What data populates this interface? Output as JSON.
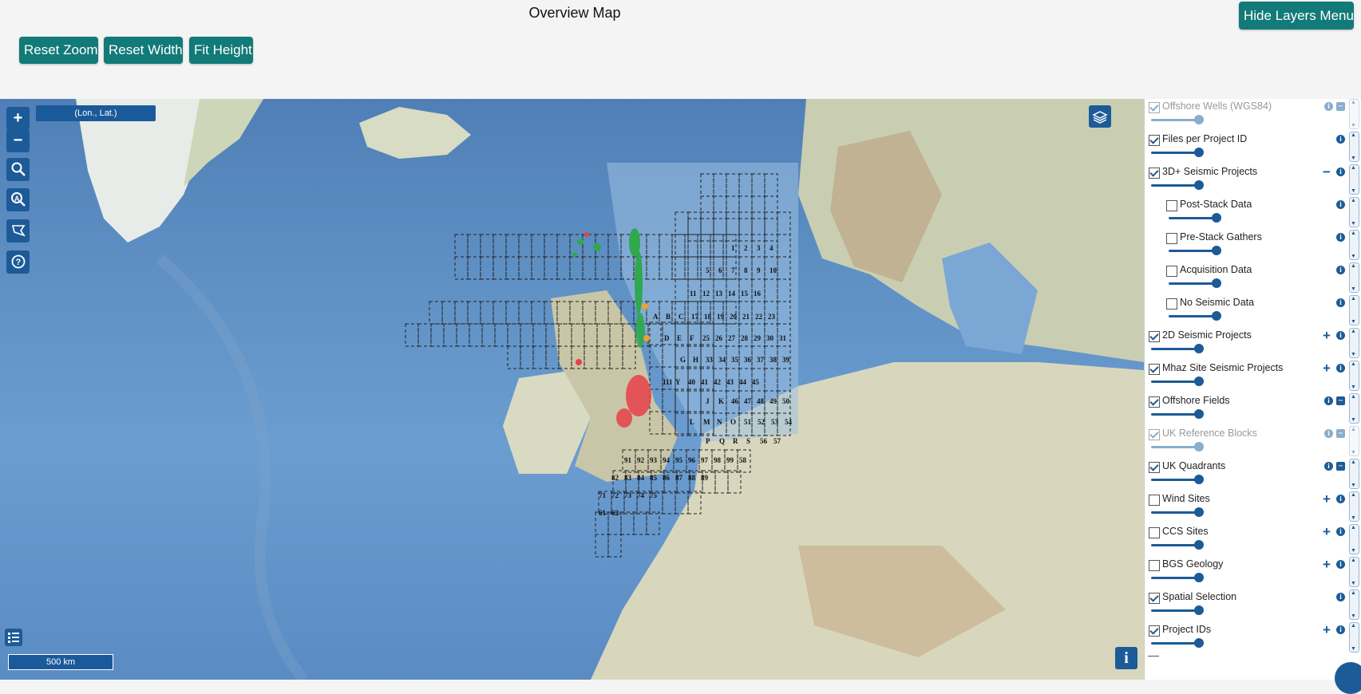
{
  "header": {
    "title": "Overview Map",
    "buttons": {
      "reset_zoom": "Reset Zoom",
      "reset_width": "Reset Width",
      "fit_height": "Fit Height",
      "hide_layers": "Hide Layers Menu"
    }
  },
  "map": {
    "coord_readout": "(Lon., Lat.)",
    "scale_label": "500 km",
    "controls": [
      "zoom-in-icon",
      "zoom-out-icon",
      "search-icon",
      "search-area-icon",
      "map-select-icon",
      "help-icon"
    ],
    "info_label": "i",
    "block_labels": {
      "row1": [
        "1",
        "2",
        "3",
        "4"
      ],
      "row2": [
        "5",
        "6",
        "7",
        "8",
        "9",
        "10"
      ],
      "row3": [
        "11",
        "12",
        "13",
        "14",
        "15",
        "16"
      ],
      "row4": [
        "A",
        "B",
        "C",
        "17",
        "18",
        "19",
        "20",
        "21",
        "22",
        "23"
      ],
      "row5": [
        "D",
        "E",
        "F",
        "25",
        "26",
        "27",
        "28",
        "29",
        "30",
        "31"
      ],
      "row6": [
        "G",
        "H",
        "33",
        "34",
        "35",
        "36",
        "37",
        "38",
        "39"
      ],
      "row7": [
        "111",
        "Y",
        "40",
        "41",
        "42",
        "43",
        "44",
        "45"
      ],
      "row8": [
        "J",
        "K",
        "46",
        "47",
        "48",
        "49",
        "50"
      ],
      "row9": [
        "L",
        "M",
        "N",
        "O",
        "51",
        "52",
        "53",
        "54"
      ],
      "row10": [
        "P",
        "Q",
        "R",
        "S",
        "56",
        "57"
      ],
      "row11": [
        "91",
        "92",
        "93",
        "94",
        "95",
        "96",
        "97",
        "98",
        "99",
        "58"
      ],
      "row12": [
        "82",
        "83",
        "84",
        "85",
        "86",
        "87",
        "88",
        "89"
      ],
      "row13": [
        "71",
        "72",
        "73",
        "74",
        "75"
      ],
      "row14": [
        "61",
        "62"
      ]
    }
  },
  "layers": [
    {
      "label": "Offshore Wells (WGS84)",
      "checked": true,
      "dim": true,
      "indent": 0,
      "icons": [
        "info-icon",
        "legend-icon"
      ]
    },
    {
      "label": "Files per Project ID",
      "checked": true,
      "dim": false,
      "indent": 0,
      "icons": [
        "info-icon"
      ]
    },
    {
      "label": "3D+ Seismic Projects",
      "checked": true,
      "dim": false,
      "indent": 0,
      "icons": [
        "collapse-icon",
        "info-icon"
      ]
    },
    {
      "label": "Post-Stack Data",
      "checked": false,
      "dim": false,
      "indent": 1,
      "icons": [
        "info-icon"
      ]
    },
    {
      "label": "Pre-Stack Gathers",
      "checked": false,
      "dim": false,
      "indent": 1,
      "icons": [
        "info-icon"
      ]
    },
    {
      "label": "Acquisition Data",
      "checked": false,
      "dim": false,
      "indent": 1,
      "icons": [
        "info-icon"
      ]
    },
    {
      "label": "No Seismic Data",
      "checked": false,
      "dim": false,
      "indent": 1,
      "icons": [
        "info-icon"
      ]
    },
    {
      "label": "2D Seismic Projects",
      "checked": true,
      "dim": false,
      "indent": 0,
      "icons": [
        "expand-icon",
        "info-icon"
      ]
    },
    {
      "label": "Mhaz Site Seismic Projects",
      "checked": true,
      "dim": false,
      "indent": 0,
      "icons": [
        "expand-icon",
        "info-icon"
      ]
    },
    {
      "label": "Offshore Fields",
      "checked": true,
      "dim": false,
      "indent": 0,
      "icons": [
        "info-icon",
        "legend-icon"
      ]
    },
    {
      "label": "UK Reference Blocks",
      "checked": true,
      "dim": true,
      "indent": 0,
      "icons": [
        "info-icon",
        "legend-icon"
      ]
    },
    {
      "label": "UK Quadrants",
      "checked": true,
      "dim": false,
      "indent": 0,
      "icons": [
        "info-icon",
        "legend-icon"
      ]
    },
    {
      "label": "Wind Sites",
      "checked": false,
      "dim": false,
      "indent": 0,
      "icons": [
        "expand-icon",
        "info-icon"
      ]
    },
    {
      "label": "CCS Sites",
      "checked": false,
      "dim": false,
      "indent": 0,
      "icons": [
        "expand-icon",
        "info-icon"
      ]
    },
    {
      "label": "BGS Geology",
      "checked": false,
      "dim": false,
      "indent": 0,
      "icons": [
        "expand-icon",
        "info-icon"
      ]
    },
    {
      "label": "Spatial Selection",
      "checked": true,
      "dim": false,
      "indent": 0,
      "icons": [
        "info-icon"
      ]
    },
    {
      "label": "Project IDs",
      "checked": true,
      "dim": false,
      "indent": 0,
      "icons": [
        "expand-icon",
        "info-icon"
      ]
    }
  ],
  "colors": {
    "accent": "#127a78",
    "map_control": "#1c5b97",
    "wells_green": "#2fa84f",
    "fields_red": "#e8404a",
    "fields_orange": "#f0a030"
  }
}
